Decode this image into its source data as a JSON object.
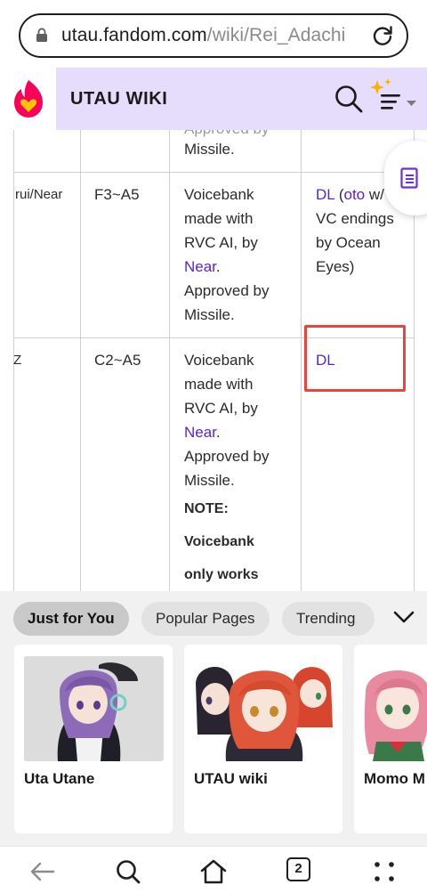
{
  "browser": {
    "url_host": "utau.fandom.com",
    "url_path": "/wiki/Rei_Adachi"
  },
  "header": {
    "wiki_title": "UTAU WIKI"
  },
  "table": {
    "top_row": {
      "partial": "Approved by",
      "line": "Missile."
    },
    "row1": {
      "name": "rui/Near",
      "range": "F3~A5",
      "desc_lines": [
        "Voicebank",
        "made with",
        "RVC AI, by"
      ],
      "near_link": "Near",
      "period": ".",
      "approved": "Approved by",
      "missile": "Missile.",
      "download": {
        "dl": "DL",
        "paren_open": " (",
        "oto": "oto",
        "rest1": " w/",
        "line2": "VC endings",
        "line3": "by Ocean",
        "line4": "Eyes)"
      }
    },
    "row2": {
      "name": "Z",
      "range": "C2~A5",
      "desc_lines": [
        "Voicebank",
        "made with",
        "RVC AI, by"
      ],
      "near_link": "Near",
      "period": ".",
      "approved": "Approved by",
      "missile": "Missile.",
      "note_label": "NOTE:",
      "note_line1": "Voicebank",
      "note_line2": "only works",
      "download": {
        "dl": "DL"
      }
    }
  },
  "recommendations": {
    "tabs": [
      "Just for You",
      "Popular Pages",
      "Trending"
    ],
    "cards": [
      {
        "title": "Uta Utane"
      },
      {
        "title": "UTAU wiki"
      },
      {
        "title": "Momo M"
      }
    ]
  },
  "bottom_nav": {
    "tab_count": "2"
  },
  "colors": {
    "link": "#5a1fd6",
    "header_bg": "#e6dcfb",
    "highlight": "#e8453c",
    "fandom_pink": "#fa005a",
    "fandom_yellow": "#ffc500"
  }
}
